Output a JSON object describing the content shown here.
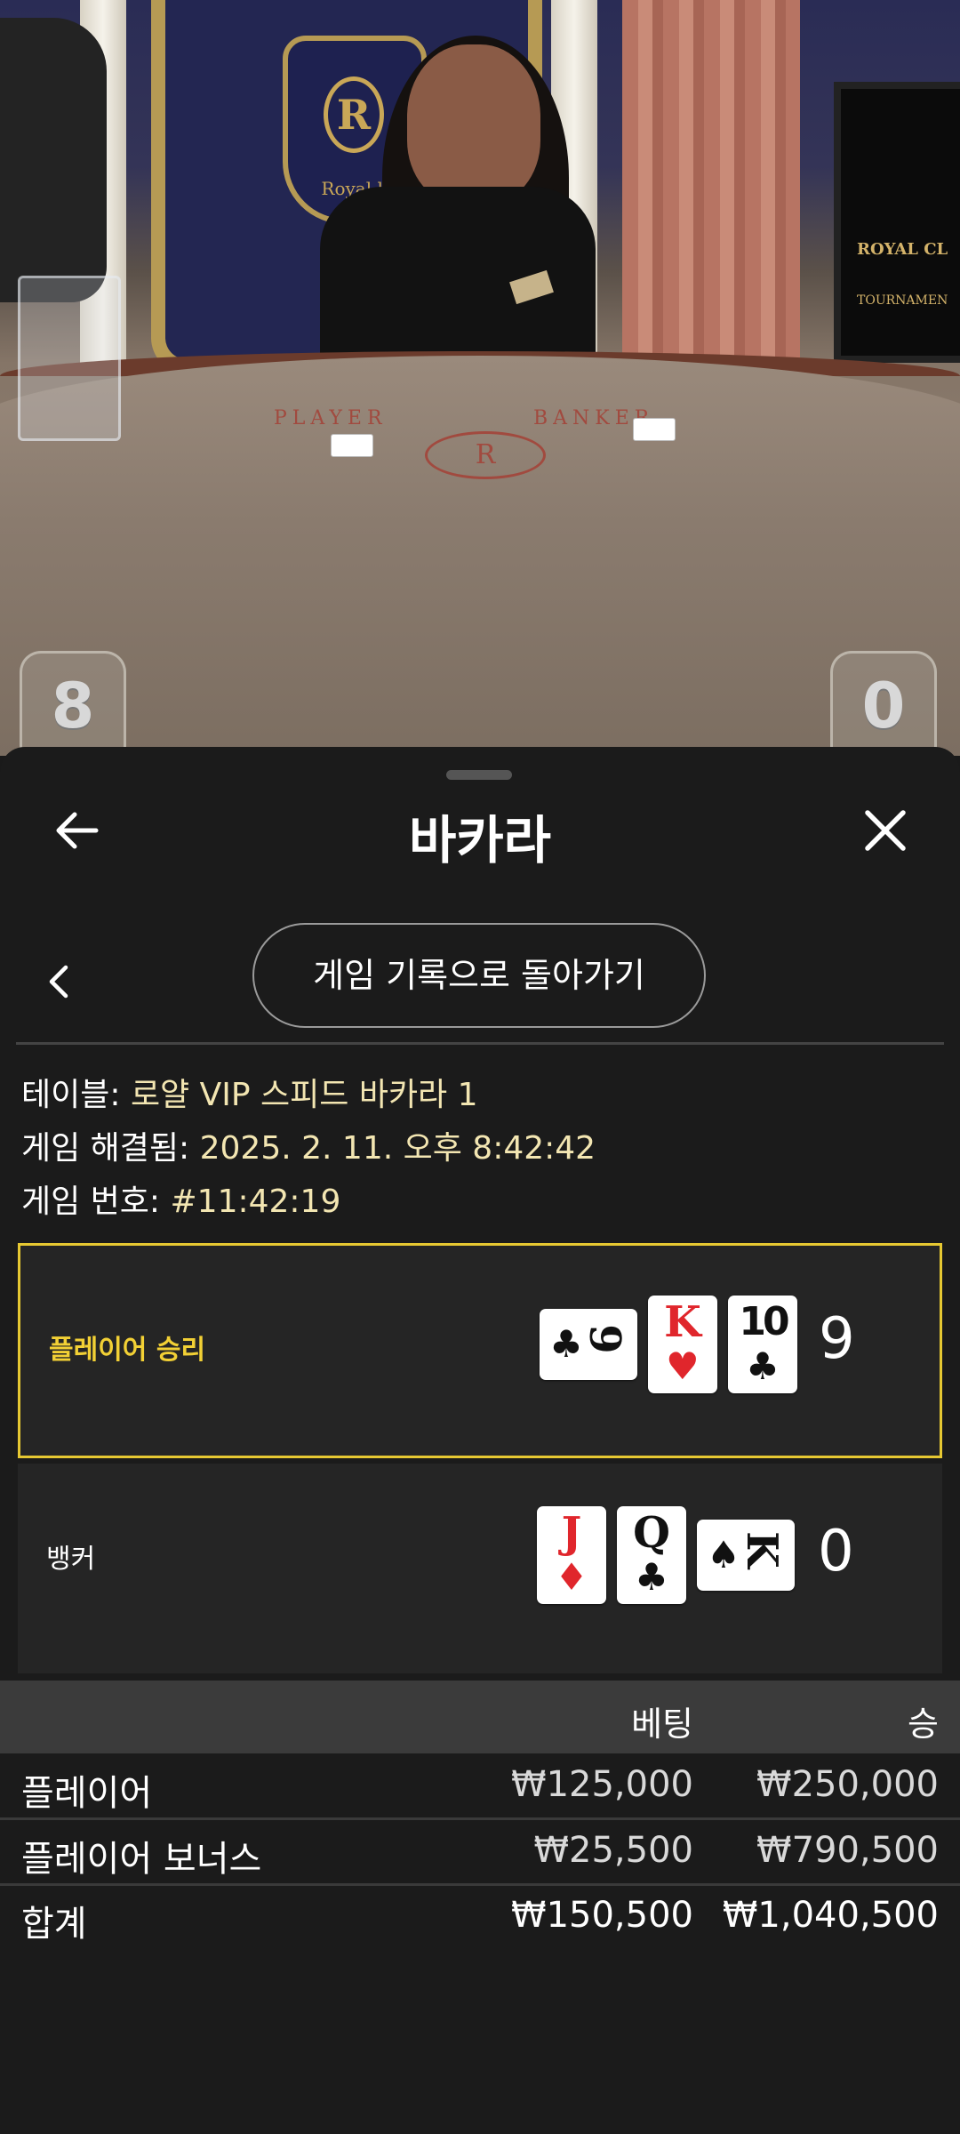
{
  "video": {
    "felt_player": "PLAYER",
    "felt_banker": "BANKER",
    "felt_logo": "R",
    "plaque_letter": "R",
    "plaque_text": "Royal.k",
    "monitor_text": "ROYAL CL",
    "monitor_sub": "TOURNAMEN",
    "player_score": "8",
    "banker_score": "0"
  },
  "header": {
    "title": "바카라",
    "back_icon": "arrow-left-icon",
    "close_icon": "close-icon"
  },
  "nav": {
    "back_to_history": "게임 기록으로 돌아가기",
    "prev_icon": "chevron-left-icon"
  },
  "info": {
    "table_label": "테이블: ",
    "table_value": "로얄 VIP 스피드 바카라 1",
    "resolved_label": "게임 해결됨: ",
    "resolved_value": "2025. 2. 11. 오후 8:42:42",
    "number_label": "게임 번호: ",
    "number_value": "#11:42:19"
  },
  "outcomes": {
    "player": {
      "label": "플레이어 승리",
      "total": "9",
      "cards": [
        {
          "rank": "9",
          "suit": "♣",
          "color": "#111111",
          "orientation": "landscape"
        },
        {
          "rank": "K",
          "suit": "♥",
          "color": "#e0262c",
          "orientation": "portrait"
        },
        {
          "rank": "10",
          "suit": "♣",
          "color": "#111111",
          "orientation": "portrait"
        }
      ]
    },
    "banker": {
      "label": "뱅커",
      "total": "0",
      "cards": [
        {
          "rank": "J",
          "suit": "♦",
          "color": "#e0262c",
          "orientation": "portrait"
        },
        {
          "rank": "Q",
          "suit": "♣",
          "color": "#111111",
          "orientation": "portrait"
        },
        {
          "rank": "K",
          "suit": "♠",
          "color": "#111111",
          "orientation": "landscape"
        }
      ]
    }
  },
  "bets": {
    "headers": {
      "bet": "베팅",
      "win": "승"
    },
    "rows": [
      {
        "label": "플레이어",
        "bet": "₩125,000",
        "win": "₩250,000"
      },
      {
        "label": "플레이어 보너스",
        "bet": "₩25,500",
        "win": "₩790,500"
      }
    ],
    "total": {
      "label": "합계",
      "bet": "₩150,500",
      "win": "₩1,040,500"
    }
  },
  "colors": {
    "win_accent": "#e6c832",
    "sheet_bg": "#1b1b1b",
    "info_value": "#f3e6b2"
  }
}
